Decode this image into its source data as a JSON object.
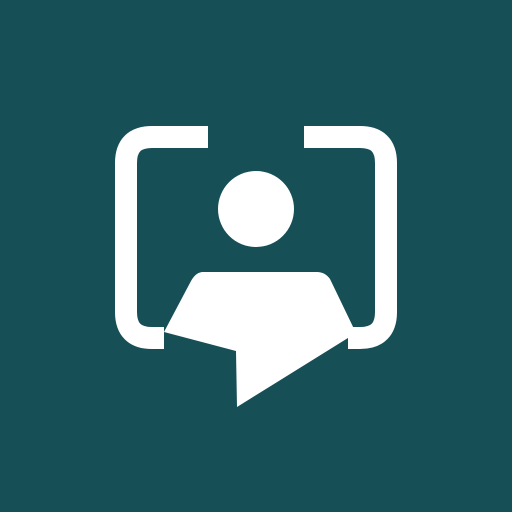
{
  "app_icon": {
    "icon": "person-in-speech-frame-icon",
    "colors": {
      "background": "#174f57",
      "foreground": "#ffffff"
    }
  }
}
